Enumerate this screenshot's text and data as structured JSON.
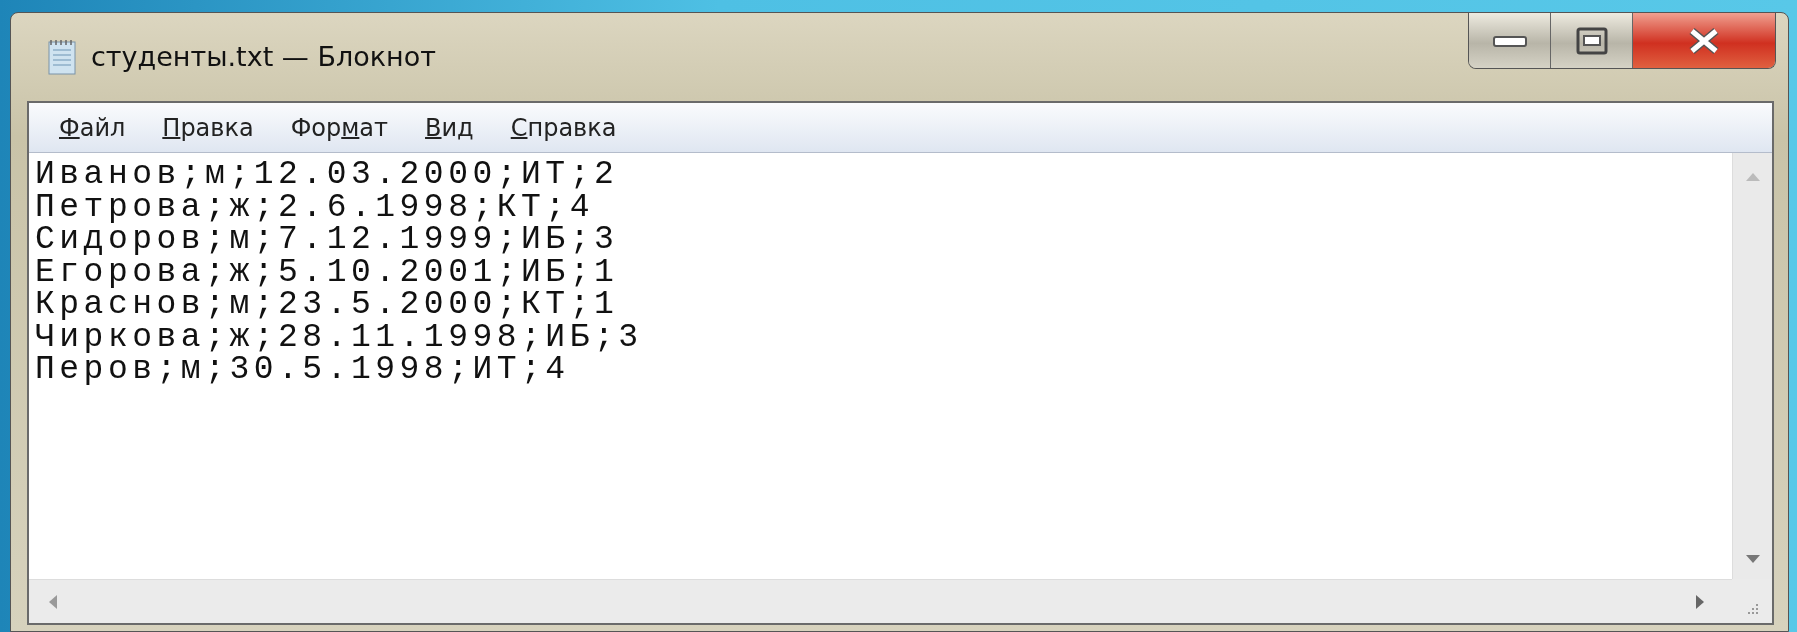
{
  "window": {
    "title": "студенты.txt — Блокнот"
  },
  "menu": [
    {
      "key": "Ф",
      "after": "айл"
    },
    {
      "key": "П",
      "after": "равка"
    },
    {
      "before": "Фор",
      "key": "м",
      "after": "ат"
    },
    {
      "key": "В",
      "after": "ид"
    },
    {
      "key": "С",
      "after": "правка"
    }
  ],
  "lines": [
    "Иванов;м;12.03.2000;ИТ;2",
    "Петрова;ж;2.6.1998;КТ;4",
    "Сидоров;м;7.12.1999;ИБ;3",
    "Егорова;ж;5.10.2001;ИБ;1",
    "Краснов;м;23.5.2000;КТ;1",
    "Чиркова;ж;28.11.1998;ИБ;3",
    "Перов;м;30.5.1998;ИТ;4"
  ]
}
